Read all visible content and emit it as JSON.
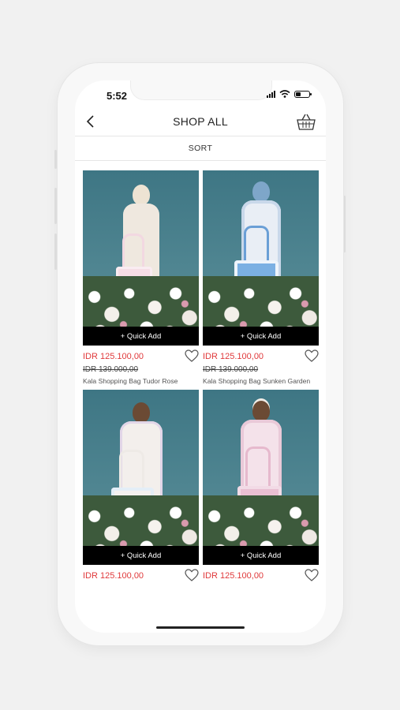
{
  "status": {
    "time": "5:52"
  },
  "nav": {
    "title": "SHOP ALL"
  },
  "sort": {
    "label": "SORT"
  },
  "quick_add_label": "+ Quick Add",
  "products": [
    {
      "price": "IDR 125.100,00",
      "old_price": "IDR 139.000,00",
      "name": "Kala Shopping Bag Tudor Rose"
    },
    {
      "price": "IDR 125.100,00",
      "old_price": "IDR 139.000,00",
      "name": "Kala Shopping Bag Sunken Garden"
    },
    {
      "price": "IDR 125.100,00",
      "old_price": "",
      "name": ""
    },
    {
      "price": "IDR 125.100,00",
      "old_price": "",
      "name": ""
    }
  ],
  "colors": {
    "sale_price": "#e0393b",
    "quick_add_bg": "#000000",
    "photo_bg": "#4f8591"
  }
}
